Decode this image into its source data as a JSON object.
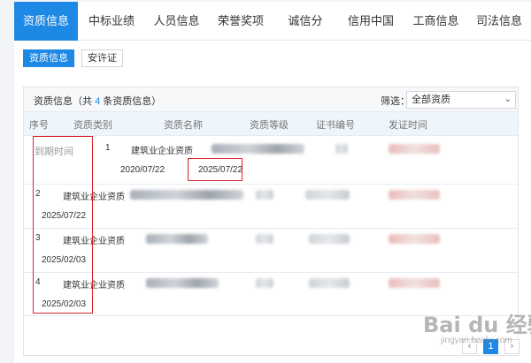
{
  "tabs": [
    {
      "label": "资质信息",
      "active": true
    },
    {
      "label": "中标业绩"
    },
    {
      "label": "人员信息"
    },
    {
      "label": "荣誉奖项"
    },
    {
      "label": "诚信分"
    },
    {
      "label": "信用中国"
    },
    {
      "label": "工商信息"
    },
    {
      "label": "司法信息"
    }
  ],
  "subtabs": [
    {
      "label": "资质信息",
      "active": true
    },
    {
      "label": "安许证"
    }
  ],
  "panel": {
    "title_prefix": "资质信息（共 ",
    "count": "4",
    "title_suffix": " 条资质信息）",
    "filter_label": "筛选：",
    "filter_value": "全部资质"
  },
  "table": {
    "headers": [
      "序号",
      "资质类别",
      "资质名称",
      "资质等级",
      "证书编号",
      "发证时间"
    ],
    "expiry_header": "到期时间",
    "rows": [
      {
        "no": "1",
        "category": "建筑业企业资质",
        "issue_date": "2020/07/22",
        "expiry": "2025/07/22"
      },
      {
        "no": "2",
        "category": "建筑业企业资质",
        "expiry": "2025/07/22"
      },
      {
        "no": "3",
        "category": "建筑业企业资质",
        "expiry": "2025/02/03"
      },
      {
        "no": "4",
        "category": "建筑业企业资质",
        "expiry": "2025/02/03"
      }
    ]
  },
  "pagination": {
    "prev": "‹",
    "current": "1",
    "next": "›"
  },
  "watermark": {
    "brand": "Bai du 经验",
    "url": "jingyan.baidu.com"
  },
  "colors": {
    "accent": "#1e88e5",
    "highlight_border": "#d9232b",
    "header_bg": "#eef5fb"
  }
}
